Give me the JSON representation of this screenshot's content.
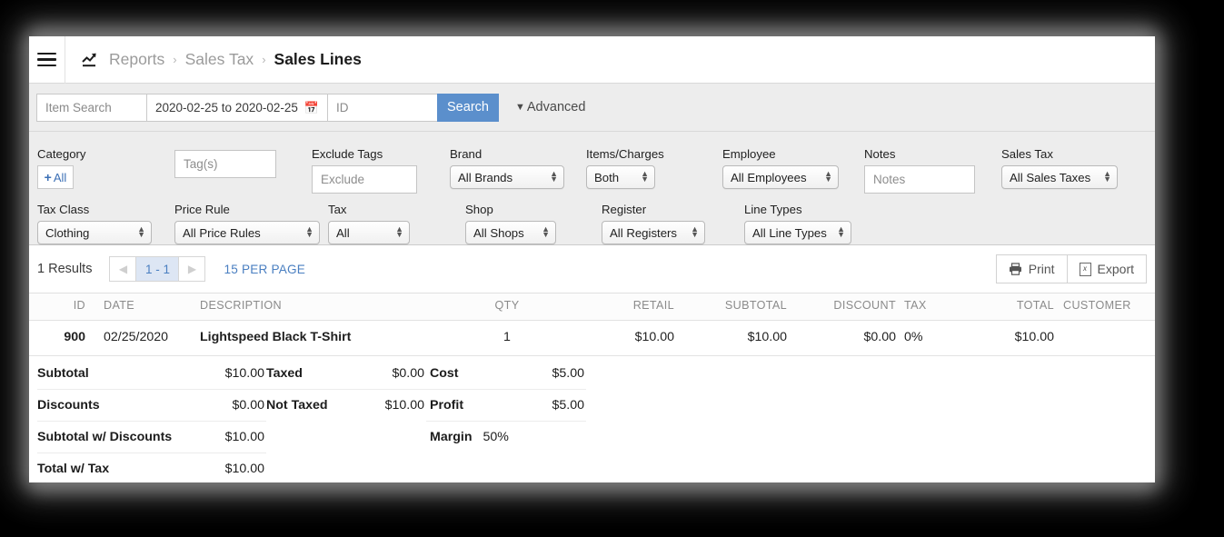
{
  "topbar": {
    "menu_icon": "hamburger-icon",
    "report_icon": "line-chart-icon",
    "breadcrumb": [
      {
        "label": "Reports",
        "current": false
      },
      {
        "label": "Sales Tax",
        "current": false
      },
      {
        "label": "Sales Lines",
        "current": true
      }
    ],
    "separator": "›"
  },
  "search": {
    "item_placeholder": "Item Search",
    "item_value": "",
    "date_value": "2020-02-25 to 2020-02-25",
    "calendar_icon": "calendar-icon",
    "id_placeholder": "ID",
    "id_value": "",
    "search_label": "Search",
    "advanced_label": "Advanced",
    "advanced_chevron": "chevron-down-icon",
    "accent": "#5b8fcc"
  },
  "filters": {
    "category": {
      "label": "Category",
      "button_label": "All",
      "plus_icon": "plus-icon"
    },
    "tags": {
      "placeholder": "Tag(s)",
      "value": ""
    },
    "exclude_tags": {
      "label": "Exclude Tags",
      "placeholder": "Exclude",
      "value": ""
    },
    "brand": {
      "label": "Brand",
      "value": "All Brands"
    },
    "items_charges": {
      "label": "Items/Charges",
      "value": "Both"
    },
    "employee": {
      "label": "Employee",
      "value": "All Employees"
    },
    "notes": {
      "label": "Notes",
      "placeholder": "Notes",
      "value": ""
    },
    "sales_tax": {
      "label": "Sales Tax",
      "value": "All Sales Taxes"
    },
    "tax_class": {
      "label": "Tax Class",
      "value": "Clothing"
    },
    "price_rule": {
      "label": "Price Rule",
      "value": "All Price Rules"
    },
    "tax": {
      "label": "Tax",
      "value": "All"
    },
    "shop": {
      "label": "Shop",
      "value": "All Shops"
    },
    "register": {
      "label": "Register",
      "value": "All Registers"
    },
    "line_types": {
      "label": "Line Types",
      "value": "All Line Types"
    }
  },
  "resultsbar": {
    "count_label": "1 Results",
    "prev_icon": "triangle-left-icon",
    "page_label": "1 - 1",
    "next_icon": "triangle-right-icon",
    "per_page_label": "15 PER PAGE",
    "print_label": "Print",
    "print_icon": "printer-icon",
    "export_label": "Export",
    "export_icon": "spreadsheet-icon",
    "export_icon_glyph": "x"
  },
  "table": {
    "columns": [
      "ID",
      "DATE",
      "DESCRIPTION",
      "QTY",
      "RETAIL",
      "SUBTOTAL",
      "DISCOUNT",
      "TAX",
      "TOTAL",
      "CUSTOMER"
    ],
    "rows": [
      {
        "id": "900",
        "date": "02/25/2020",
        "description": "Lightspeed Black T-Shirt",
        "qty": "1",
        "retail": "$10.00",
        "subtotal": "$10.00",
        "discount": "$0.00",
        "tax": "0%",
        "total": "$10.00",
        "customer": ""
      }
    ]
  },
  "summary": {
    "col_a": [
      {
        "key": "Subtotal",
        "value": "$10.00"
      },
      {
        "key": "Discounts",
        "value": "$0.00"
      },
      {
        "key": "Subtotal w/ Discounts",
        "value": "$10.00"
      },
      {
        "key": "Total w/ Tax",
        "value": "$10.00"
      }
    ],
    "col_b": [
      {
        "key": "Taxed",
        "value": "$0.00"
      },
      {
        "key": "Not Taxed",
        "value": "$10.00"
      }
    ],
    "col_c": [
      {
        "key": "Cost",
        "value": "$5.00"
      },
      {
        "key": "Profit",
        "value": "$5.00"
      },
      {
        "key": "Margin",
        "value": "50%"
      }
    ]
  }
}
